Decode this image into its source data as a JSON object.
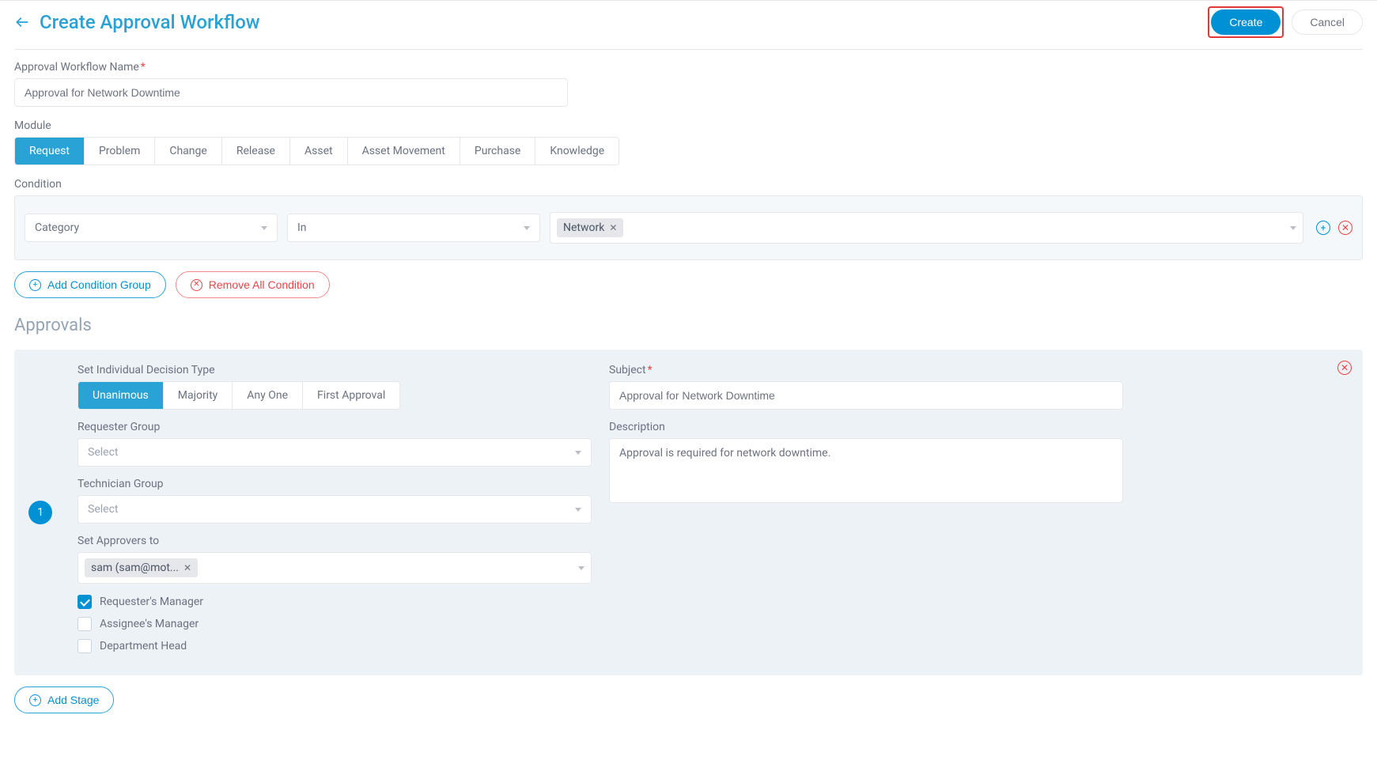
{
  "header": {
    "title": "Create Approval Workflow",
    "create_label": "Create",
    "cancel_label": "Cancel"
  },
  "workflow_name": {
    "label": "Approval Workflow Name",
    "value": "Approval for Network Downtime"
  },
  "module": {
    "label": "Module",
    "tabs": [
      {
        "label": "Request",
        "active": true
      },
      {
        "label": "Problem",
        "active": false
      },
      {
        "label": "Change",
        "active": false
      },
      {
        "label": "Release",
        "active": false
      },
      {
        "label": "Asset",
        "active": false
      },
      {
        "label": "Asset Movement",
        "active": false
      },
      {
        "label": "Purchase",
        "active": false
      },
      {
        "label": "Knowledge",
        "active": false
      }
    ]
  },
  "condition": {
    "label": "Condition",
    "field": "Category",
    "operator": "In",
    "value_tag": "Network",
    "add_group_label": "Add Condition Group",
    "remove_all_label": "Remove All Condition"
  },
  "approvals": {
    "section_title": "Approvals",
    "stage_number": "1",
    "decision_label": "Set Individual Decision Type",
    "decision_tabs": [
      {
        "label": "Unanimous",
        "active": true
      },
      {
        "label": "Majority",
        "active": false
      },
      {
        "label": "Any One",
        "active": false
      },
      {
        "label": "First Approval",
        "active": false
      }
    ],
    "requester_group_label": "Requester Group",
    "technician_group_label": "Technician Group",
    "select_placeholder": "Select",
    "approvers_label": "Set Approvers to",
    "approver_tag": "sam (sam@mot...",
    "chk_requester_manager": "Requester's Manager",
    "chk_assignee_manager": "Assignee's Manager",
    "chk_department_head": "Department Head",
    "subject_label": "Subject",
    "subject_value": "Approval for Network Downtime",
    "description_label": "Description",
    "description_value": "Approval is required for network downtime.",
    "add_stage_label": "Add Stage"
  }
}
